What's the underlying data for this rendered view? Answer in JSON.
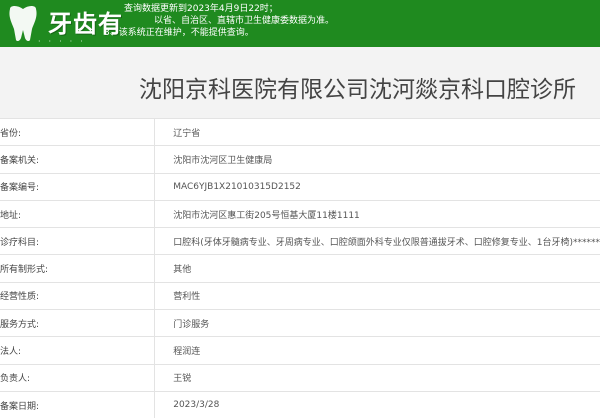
{
  "banner": {
    "logo_text": "牙齿有",
    "notice_lines": [
      "查询数据更新到2023年4月9日22时；",
      "以省、自治区、直辖市卫生健康委数据为准。",
      "3、该系统正在维护，不能提供查询。"
    ],
    "color": "#1f8a1f"
  },
  "page_title": "沈阳京科医院有限公司沈河燚京科口腔诊所",
  "rows": [
    {
      "label": "省份:",
      "value": "辽宁省"
    },
    {
      "label": "备案机关:",
      "value": "沈阳市沈河区卫生健康局"
    },
    {
      "label": "备案编号:",
      "value": "MAC6YJB1X21010315D2152"
    },
    {
      "label": "地址:",
      "value": "沈阳市沈河区惠工街205号恒基大厦11楼1111"
    },
    {
      "label": "诊疗科目:",
      "value": "口腔科(牙体牙髓病专业、牙周病专业、口腔颌面外科专业仅限普通拔牙术、口腔修复专业、1台牙椅)******"
    },
    {
      "label": "所有制形式:",
      "value": "其他"
    },
    {
      "label": "经营性质:",
      "value": "营利性"
    },
    {
      "label": "服务方式:",
      "value": "门诊服务"
    },
    {
      "label": "法人:",
      "value": "程润连"
    },
    {
      "label": "负责人:",
      "value": "王锐"
    },
    {
      "label": "备案日期:",
      "value": "2023/3/28"
    }
  ]
}
